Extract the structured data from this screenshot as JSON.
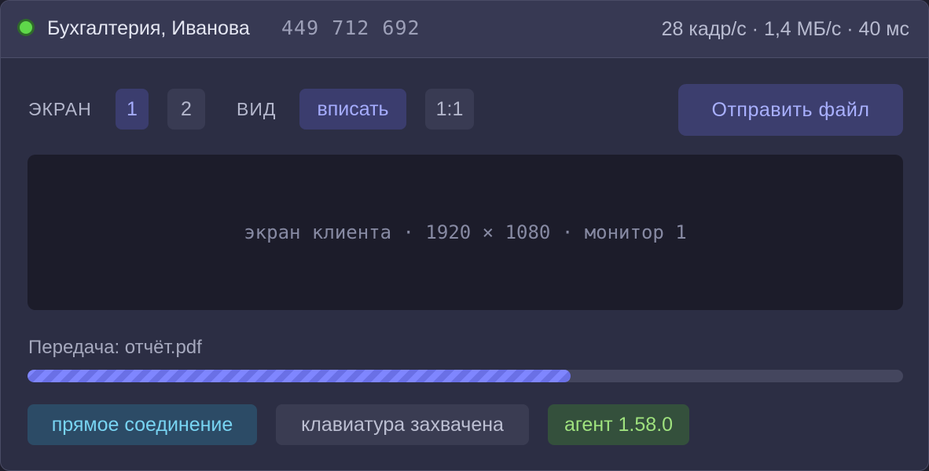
{
  "titlebar": {
    "host_name": "Бухгалтерия, Иванова",
    "host_id": "449 712 692",
    "stats": "28 кадр/с · 1,4 МБ/с · 40 мс",
    "status_color": "#5fd84a"
  },
  "toolbar": {
    "screen_label": "ЭКРАН",
    "screens": [
      "1",
      "2"
    ],
    "active_screen": "1",
    "view_label": "ВИД",
    "view_options": [
      "вписать",
      "1:1"
    ],
    "active_view": "вписать",
    "send_file_label": "Отправить файл"
  },
  "remote_screen": {
    "caption": "экран клиента · 1920 × 1080 · монитор 1"
  },
  "transfer": {
    "label": "Передача: отчёт.pdf",
    "progress_percent": 62
  },
  "badges": {
    "connection": "прямое соединение",
    "keyboard": "клавиатура захвачена",
    "agent": "агент 1.58.0"
  },
  "colors": {
    "accent": "#7f86ff",
    "background": "#2c2e44",
    "titlebar": "#373953"
  }
}
